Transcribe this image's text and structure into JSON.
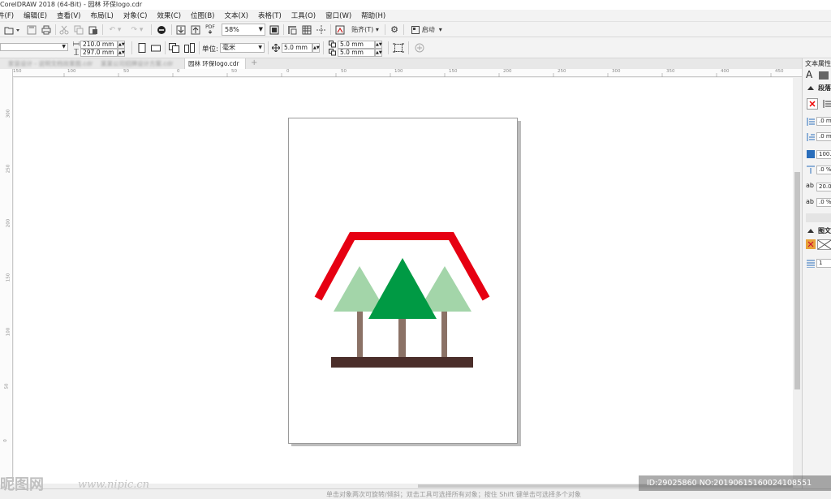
{
  "app": {
    "title": "CorelDRAW 2018 (64-Bit) - 园林 环保logo.cdr"
  },
  "menu": [
    "件(F)",
    "编辑(E)",
    "查看(V)",
    "布局(L)",
    "对象(C)",
    "效果(C)",
    "位图(B)",
    "文本(X)",
    "表格(T)",
    "工具(O)",
    "窗口(W)",
    "帮助(H)"
  ],
  "toolbar": {
    "zoom": "58%",
    "snap_label": "贴齐(T)",
    "launch_label": "启动",
    "pdf_label": "PDF"
  },
  "propbar": {
    "width": "210.0 mm",
    "height": "297.0 mm",
    "unit_label": "单位:",
    "unit_value": "毫米",
    "nudge": "5.0 mm",
    "dup_x": "5.0 mm",
    "dup_y": "5.0 mm"
  },
  "tabs": [
    {
      "label": "家装设计 - 说明文档效果图.cdr",
      "blurred": true
    },
    {
      "label": "某某公司招牌设计方案.cdr",
      "blurred": true
    },
    {
      "label": "园林 环保logo.cdr",
      "active": true
    }
  ],
  "ruler": {
    "h": [
      "150",
      "100",
      "50",
      "0",
      "50",
      "100",
      "150",
      "200",
      "250",
      "300",
      "350",
      "400",
      "450"
    ],
    "v": [
      "300",
      "250",
      "200",
      "150",
      "100",
      "50",
      "0",
      "50"
    ]
  },
  "docker": {
    "title": "文本属性",
    "section_paragraph": "段落",
    "fields": [
      ".0 mm",
      ".0 mm",
      "100.0",
      ".0 %",
      "20.0 %",
      ".0 %"
    ],
    "section_graphic": "图文",
    "columns": "1"
  },
  "colors": {
    "roof": "#e60012",
    "tree_light": "#a3d5a9",
    "tree_dark": "#009a44",
    "trunk": "#8b7266",
    "ground": "#4b2e2a"
  },
  "status": {
    "hint": "单击对象两次可旋转/倾斜；双击工具可选择所有对象；按住 Shift 键单击可选择多个对象"
  },
  "watermark": {
    "logo": "昵图网",
    "url": "www.nipic.cn",
    "id": "ID:29025860 NO:20190615160024108551"
  }
}
